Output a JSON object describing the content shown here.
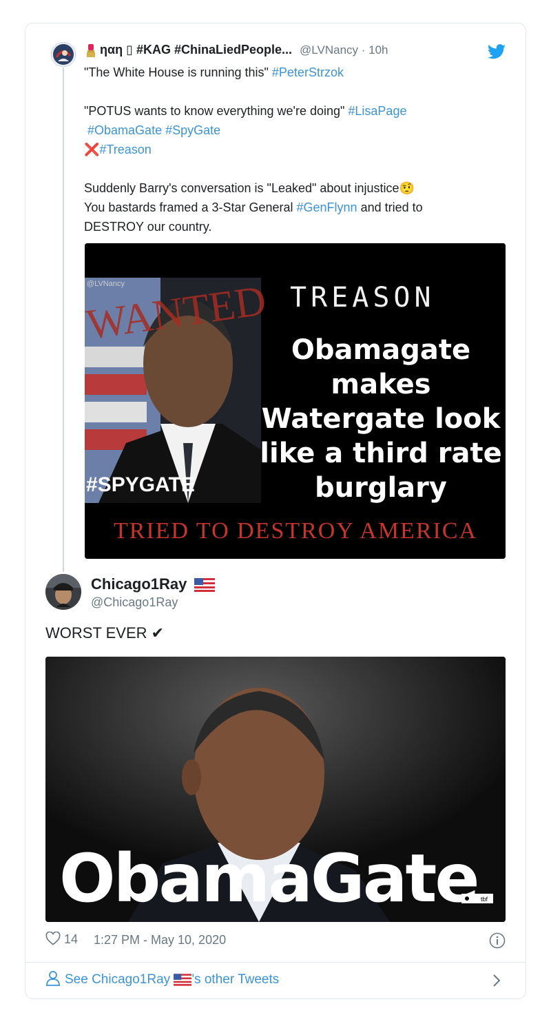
{
  "quoted_tweet": {
    "name": "ηαη ▯ #KAG #ChinaLiedPeople...",
    "handle": "@LVNancy",
    "time": "10h",
    "line1_text": "\"The White House is running this\" ",
    "line1_tag": "#PeterStrzok",
    "line2_text": "\"POTUS wants to know everything we're doing\" ",
    "line2_tag": "#LisaPage",
    "line3_tag_a": "#ObamaGate",
    "line3_tag_b": "#SpyGate",
    "line4_mark": "❌",
    "line4_tag": "#Treason",
    "line5_text": "Suddenly Barry's conversation is \"Leaked\" about injustice🤨",
    "line6_pre": "You bastards framed a 3-Star General ",
    "line6_tag": "#GenFlynn",
    "line6_post": " and tried to",
    "line7_text": "DESTROY our country.",
    "image": {
      "watermark": "@LVNancy",
      "wanted": "WANTED",
      "treason": "TREASON",
      "headline_1": "Obamagate",
      "headline_2": "makes",
      "headline_3": "Watergate look",
      "headline_4": "like a third rate",
      "headline_5": "burglary",
      "spygate": "#SPYGATE",
      "bottom": "TRIED TO DESTROY AMERICA"
    }
  },
  "main_tweet": {
    "name": "Chicago1Ray",
    "handle": "@Chicago1Ray",
    "text": "WORST EVER ✔",
    "image": {
      "caption": "ObamaGate",
      "badge": "tbf"
    },
    "likes": "14",
    "timestamp": "1:27 PM - May 10, 2020"
  },
  "see_other": {
    "prefix": "See Chicago1Ray ",
    "suffix": "'s other Tweets"
  },
  "colors": {
    "link": "#3b94d9",
    "muted": "#697882",
    "border": "#e1e8ed",
    "twitter_blue": "#1da1f2"
  }
}
